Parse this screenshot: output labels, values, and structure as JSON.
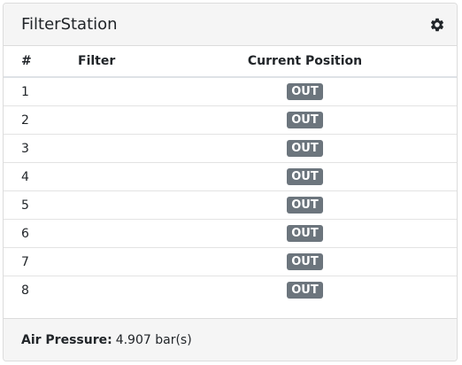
{
  "header": {
    "title": "FilterStation",
    "settings_icon": "gear-icon"
  },
  "table": {
    "columns": [
      "#",
      "Filter",
      "Current Position"
    ],
    "rows": [
      {
        "num": "1",
        "filter": "",
        "position": "OUT"
      },
      {
        "num": "2",
        "filter": "",
        "position": "OUT"
      },
      {
        "num": "3",
        "filter": "",
        "position": "OUT"
      },
      {
        "num": "4",
        "filter": "",
        "position": "OUT"
      },
      {
        "num": "5",
        "filter": "",
        "position": "OUT"
      },
      {
        "num": "6",
        "filter": "",
        "position": "OUT"
      },
      {
        "num": "7",
        "filter": "",
        "position": "OUT"
      },
      {
        "num": "8",
        "filter": "",
        "position": "OUT"
      }
    ]
  },
  "footer": {
    "label": "Air Pressure:",
    "value": "4.907 bar(s)"
  },
  "colors": {
    "badge_bg": "#6c757d",
    "badge_text": "#ffffff",
    "header_bg": "#f5f5f5"
  }
}
